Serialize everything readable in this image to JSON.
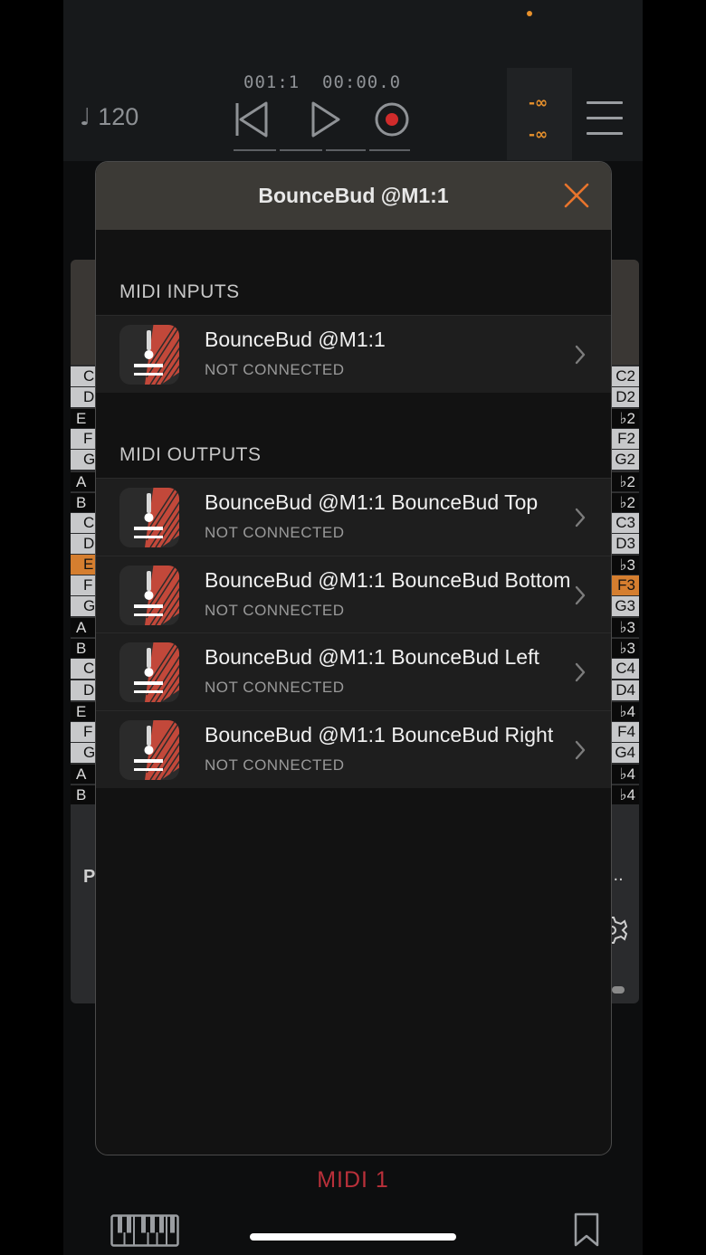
{
  "transport": {
    "bar_position": "001:1",
    "time_position": "00:00.0",
    "tempo": "120",
    "tempo_glyph": "♩",
    "meter_top": "-∞",
    "meter_bottom": "-∞"
  },
  "colors": {
    "accent_orange": "#e8912c",
    "close_orange": "#e8742c",
    "midi_label_red": "#b9303a",
    "modal_header": "#3c3a36",
    "row_background": "#1e1e1e"
  },
  "keyboard_left": [
    "C",
    "D",
    "E",
    "F",
    "G",
    "A",
    "B",
    "C",
    "D",
    "E",
    "F",
    "G",
    "A",
    "B",
    "C",
    "D",
    "E",
    "F",
    "G",
    "A",
    "B"
  ],
  "keyboard_right": [
    "C2",
    "D2",
    "♭2",
    "F2",
    "G2",
    "♭2",
    "♭2",
    "C3",
    "D3",
    "♭3",
    "F3",
    "G3",
    "♭3",
    "♭3",
    "C4",
    "D4",
    "♭4",
    "F4",
    "G4",
    "♭4",
    "♭4"
  ],
  "peek": {
    "left_letter": "P",
    "right_dots": "..."
  },
  "modal": {
    "title": "BounceBud @M1:1",
    "inputs_header": "MIDI INPUTS",
    "outputs_header": "MIDI OUTPUTS",
    "inputs": [
      {
        "name": "BounceBud @M1:1",
        "status": "NOT CONNECTED",
        "icon": "bouncebud-app-icon"
      }
    ],
    "outputs": [
      {
        "name": "BounceBud @M1:1 BounceBud Top",
        "status": "NOT CONNECTED",
        "icon": "bouncebud-app-icon"
      },
      {
        "name": "BounceBud @M1:1 BounceBud Bottom",
        "status": "NOT CONNECTED",
        "icon": "bouncebud-app-icon"
      },
      {
        "name": "BounceBud @M1:1 BounceBud Left",
        "status": "NOT CONNECTED",
        "icon": "bouncebud-app-icon"
      },
      {
        "name": "BounceBud @M1:1 BounceBud Right",
        "status": "NOT CONNECTED",
        "icon": "bouncebud-app-icon"
      }
    ]
  },
  "bottom_bar": {
    "track_label": "MIDI 1"
  }
}
